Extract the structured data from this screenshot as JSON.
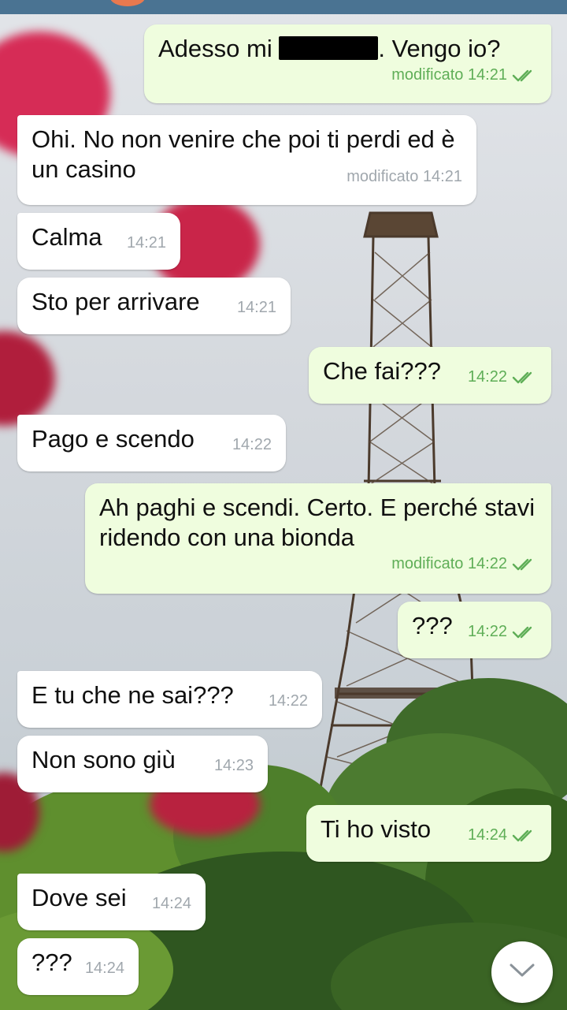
{
  "messages": [
    {
      "id": "m1",
      "direction": "out",
      "text_before": "Adesso mi ",
      "text_after": ". Vengo io?",
      "edited_label": "modificato",
      "time": "14:21",
      "status": "read",
      "redacted": true
    },
    {
      "id": "m2",
      "direction": "in",
      "text": "Ohi. No non venire che poi ti perdi ed è un casino",
      "edited_label": "modificato",
      "time": "14:21"
    },
    {
      "id": "m3",
      "direction": "in",
      "text": "Calma",
      "time": "14:21"
    },
    {
      "id": "m4",
      "direction": "in",
      "text": "Sto per arrivare",
      "time": "14:21"
    },
    {
      "id": "m5",
      "direction": "out",
      "text": "Che fai???",
      "time": "14:22",
      "status": "read"
    },
    {
      "id": "m6",
      "direction": "in",
      "text": "Pago e scendo",
      "time": "14:22"
    },
    {
      "id": "m7",
      "direction": "out",
      "text": "Ah paghi e scendi. Certo. E perché stavi ridendo con una bionda",
      "edited_label": "modificato",
      "time": "14:22",
      "status": "read"
    },
    {
      "id": "m8",
      "direction": "out",
      "text": "???",
      "time": "14:22",
      "status": "read"
    },
    {
      "id": "m9",
      "direction": "in",
      "text": "E tu che ne sai???",
      "time": "14:22"
    },
    {
      "id": "m10",
      "direction": "in",
      "text": "Non sono giù",
      "time": "14:23"
    },
    {
      "id": "m11",
      "direction": "out",
      "text": "Ti ho visto",
      "time": "14:24",
      "status": "read"
    },
    {
      "id": "m12",
      "direction": "in",
      "text": "Dove sei",
      "time": "14:24"
    },
    {
      "id": "m13",
      "direction": "in",
      "text": "???",
      "time": "14:24"
    }
  ],
  "icons": {
    "read_receipt": "double-check-icon",
    "scroll_down": "chevron-down-icon"
  },
  "colors": {
    "incoming_bubble": "#ffffff",
    "outgoing_bubble": "#effdde",
    "outgoing_meta": "#5fae57",
    "incoming_meta": "#a0a7ad",
    "top_bar": "#4a7392"
  }
}
